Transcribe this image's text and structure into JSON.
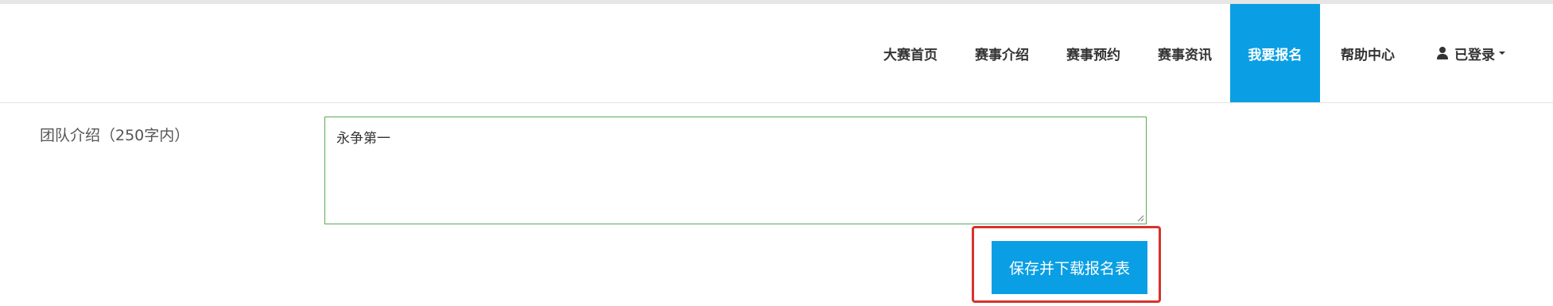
{
  "nav": {
    "items": [
      {
        "label": "大赛首页"
      },
      {
        "label": "赛事介绍"
      },
      {
        "label": "赛事预约"
      },
      {
        "label": "赛事资讯"
      },
      {
        "label": "我要报名",
        "active": true
      },
      {
        "label": "帮助中心"
      }
    ],
    "user_label": "已登录"
  },
  "form": {
    "team_intro_label": "团队介绍（250字内）",
    "team_intro_value": "永争第一",
    "submit_label": "保存并下载报名表"
  },
  "colors": {
    "accent": "#0a9fe4",
    "highlight": "#d9322c",
    "field_border": "#5aaa5a"
  }
}
